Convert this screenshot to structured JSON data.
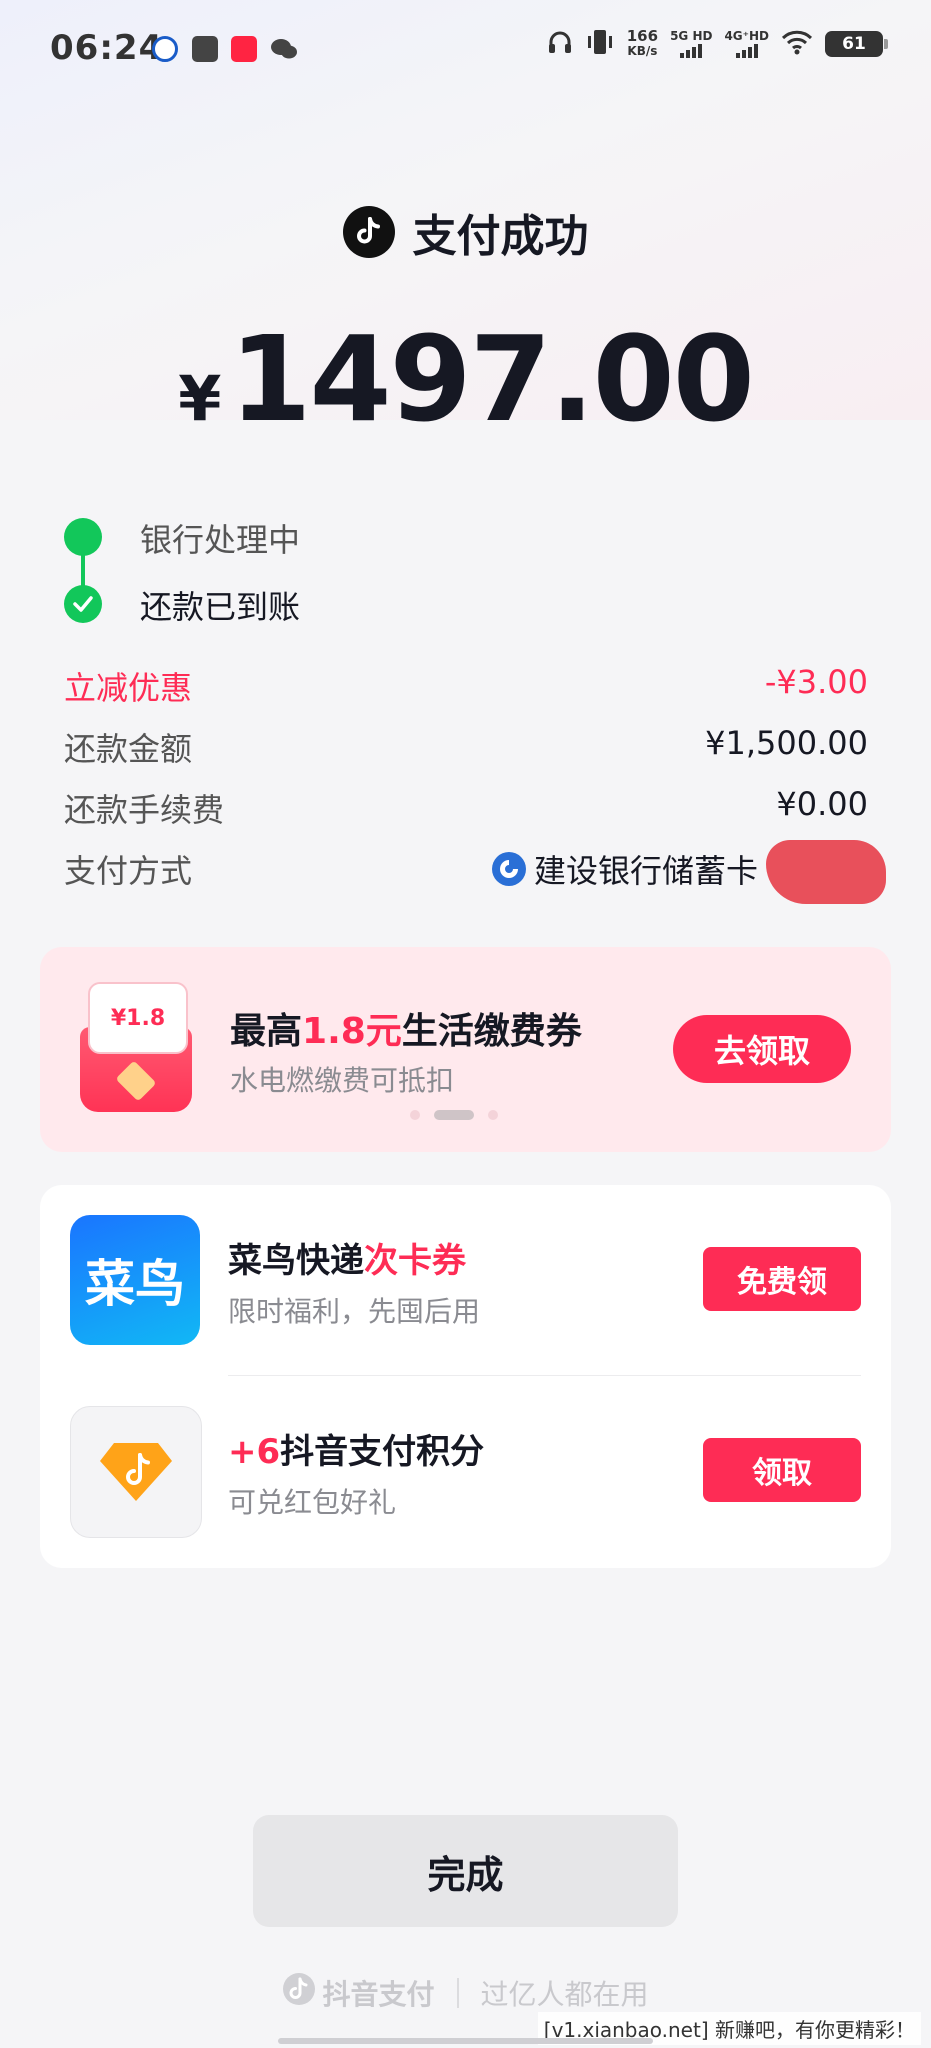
{
  "status_bar": {
    "time": "06:24",
    "net_speed_value": "166",
    "net_speed_unit": "KB/s",
    "sim1_label": "5G HD",
    "sim2_label": "4G⁺HD",
    "battery": "61",
    "app_icons": [
      "ccb-icon",
      "calendar-icon",
      "xiaohongshu-icon",
      "wechat-icon"
    ],
    "app_icon_colors": [
      "#1a5cc8",
      "#444444",
      "#ff2442",
      "#444444"
    ]
  },
  "header": {
    "title": "支付成功",
    "currency": "¥",
    "amount": "1497.00"
  },
  "progress": {
    "steps": [
      {
        "label": "银行处理中"
      },
      {
        "label": "还款已到账"
      }
    ],
    "color": "#12c75a"
  },
  "details": {
    "rows": [
      {
        "key": "立减优惠",
        "value": "-¥3.00"
      },
      {
        "key": "还款金额",
        "value": "¥1,500.00"
      },
      {
        "key": "还款手续费",
        "value": "¥0.00"
      },
      {
        "key": "支付方式",
        "value": "建设银行储蓄卡"
      }
    ]
  },
  "promo": {
    "coupon_label": "¥1.8",
    "title_prefix": "最高",
    "title_highlight": "1.8元",
    "title_suffix": "生活缴费券",
    "subtitle": "水电燃缴费可抵扣",
    "button": "去领取",
    "pager_active": 2,
    "pager_total": 3
  },
  "offers": [
    {
      "icon_text": "菜鸟",
      "title_main": "菜鸟快递",
      "title_highlight": "次卡券",
      "subtitle": "限时福利，先囤后用",
      "button": "免费领"
    },
    {
      "title_highlight": "+6",
      "title_main": "抖音支付积分",
      "subtitle": "可兑红包好礼",
      "button": "领取"
    }
  ],
  "footer": {
    "done": "完成",
    "brand": "抖音支付",
    "slogan": "过亿人都在用"
  },
  "watermark": "[v1.xianbao.net] 新赚吧，有你更精彩！",
  "colors": {
    "accent": "#fe2c55",
    "success": "#12c75a",
    "text": "#161823"
  }
}
